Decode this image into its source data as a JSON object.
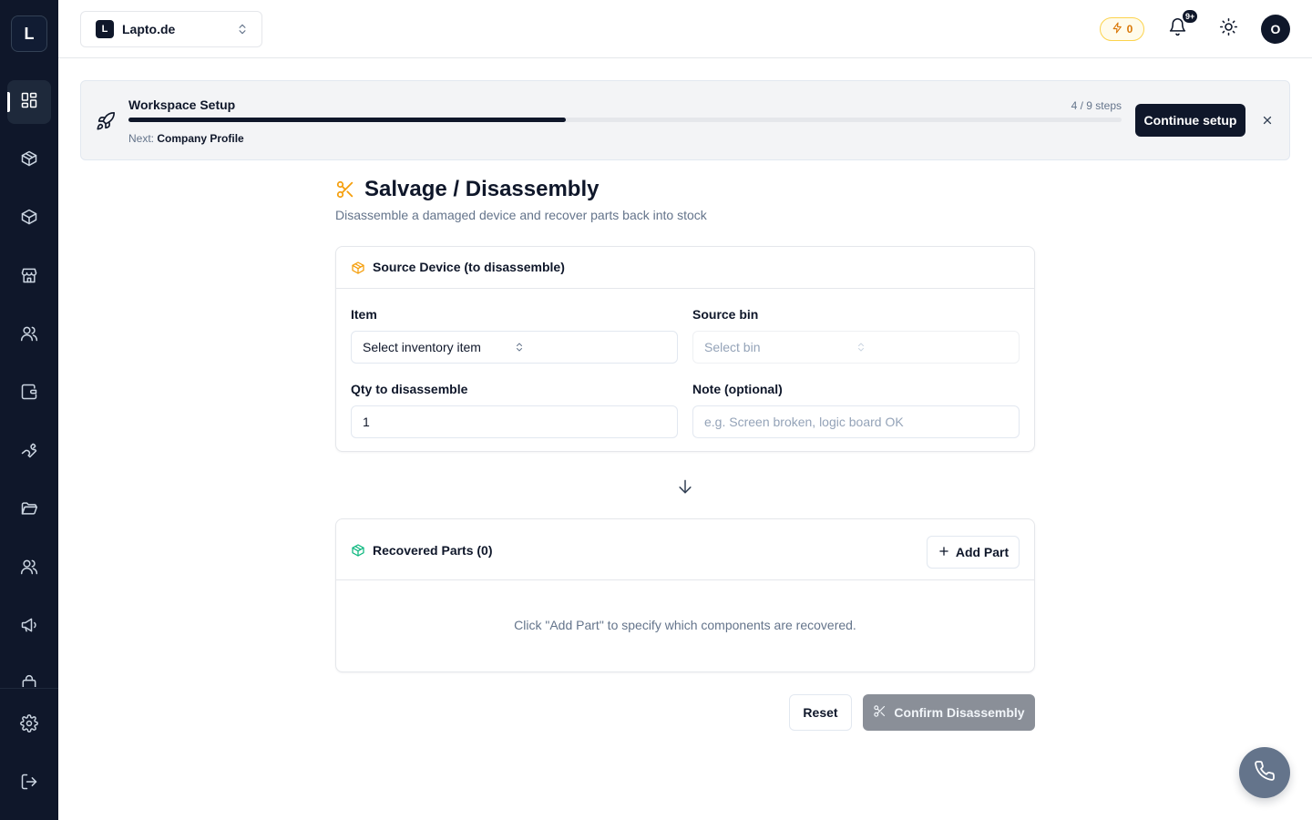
{
  "app": {
    "logo_letter": "L"
  },
  "workspace": {
    "badge": "L",
    "name": "Lapto.de"
  },
  "header": {
    "credits": "0",
    "notifications_badge": "9+",
    "avatar_initial": "O"
  },
  "setup": {
    "title": "Workspace Setup",
    "steps_text": "4 / 9 steps",
    "progress": 0.44,
    "next_label": "Next:",
    "next_value": "Company Profile",
    "continue_label": "Continue setup"
  },
  "page": {
    "title": "Salvage / Disassembly",
    "subtitle": "Disassemble a damaged device and recover parts back into stock"
  },
  "source_card": {
    "title": "Source Device (to disassemble)",
    "item_label": "Item",
    "item_value": "Select inventory item",
    "bin_label": "Source bin",
    "bin_value": "Select bin",
    "qty_label": "Qty to disassemble",
    "qty_value": "1",
    "note_label": "Note (optional)",
    "note_placeholder": "e.g. Screen broken, logic board OK"
  },
  "parts_card": {
    "title": "Recovered Parts (0)",
    "add_label": "Add Part",
    "empty_text": "Click \"Add Part\" to specify which components are recovered."
  },
  "actions": {
    "reset_label": "Reset",
    "confirm_label": "Confirm Disassembly"
  },
  "colors": {
    "sidebar": "#0f172a",
    "accent_orange": "#f59e0b",
    "accent_green": "#10b981",
    "disabled_button": "#8a8f98"
  }
}
